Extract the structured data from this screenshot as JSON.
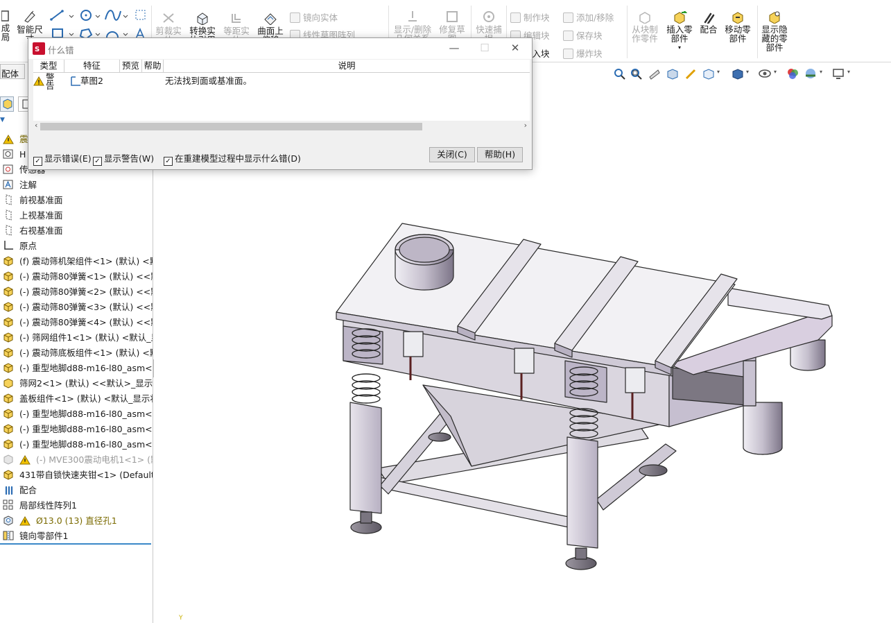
{
  "ribbon": {
    "left_cut_1": "成",
    "left_cut_2": "局",
    "smart_dim": "智能尺",
    "smart_dim_2": "寸",
    "trim": "剪裁实",
    "trim_2": "体",
    "convert": "转换实",
    "convert_2": "体引用",
    "offset": "等距实",
    "offset_2": "体",
    "surface": "曲面上",
    "surface_2": "偏移",
    "mirror": "镜向实体",
    "linear_pattern": "线性草图阵列",
    "show_delete": "显示/删除",
    "show_delete_2": "几何关系",
    "repair": "修复草",
    "repair_2": "图",
    "quick_snap": "快速捕",
    "quick_snap_2": "捉",
    "make_block": "制作块",
    "edit_block": "编辑块",
    "insert_block": "插入块",
    "add_remove": "添加/移除",
    "save_block": "保存块",
    "explode_block": "爆炸块",
    "from_block": "从块制",
    "from_block_2": "作零件",
    "insert_part": "插入零",
    "insert_part_2": "部件",
    "mate": "配合",
    "move_comp": "移动零",
    "move_comp_2": "部件",
    "show_hidden": "显示隐",
    "show_hidden_2": "藏的零",
    "show_hidden_3": "部件"
  },
  "left_panel": {
    "config_tab": "配体",
    "tree": [
      {
        "icon": "warning-icon",
        "label": "震",
        "style": "warn-text"
      },
      {
        "icon": "history-icon",
        "label": "H",
        "style": ""
      },
      {
        "icon": "sensor-icon",
        "label": "传感器",
        "style": ""
      },
      {
        "icon": "annotation-icon",
        "label": "注解",
        "style": ""
      },
      {
        "icon": "plane-icon",
        "label": "前视基准面",
        "style": ""
      },
      {
        "icon": "plane-icon",
        "label": "上视基准面",
        "style": ""
      },
      {
        "icon": "plane-icon",
        "label": "右视基准面",
        "style": ""
      },
      {
        "icon": "origin-icon",
        "label": "原点",
        "style": ""
      },
      {
        "icon": "assembly-icon",
        "label": "(f) 震动筛机架组件<1> (默认) <默认",
        "style": ""
      },
      {
        "icon": "assembly-icon",
        "label": "(-) 震动筛80弹簧<1> (默认) <<默认",
        "style": ""
      },
      {
        "icon": "assembly-icon",
        "label": "(-) 震动筛80弹簧<2> (默认) <<默认",
        "style": ""
      },
      {
        "icon": "assembly-icon",
        "label": "(-) 震动筛80弹簧<3> (默认) <<默认",
        "style": ""
      },
      {
        "icon": "assembly-icon",
        "label": "(-) 震动筛80弹簧<4> (默认) <<默认",
        "style": ""
      },
      {
        "icon": "assembly-icon",
        "label": "(-) 筛网组件1<1> (默认) <默认_显示",
        "style": ""
      },
      {
        "icon": "assembly-icon",
        "label": "(-) 震动筛底板组件<1> (默认) <默认",
        "style": ""
      },
      {
        "icon": "assembly-icon",
        "label": "(-) 重型地脚d88-m16-l80_asm<1>",
        "style": ""
      },
      {
        "icon": "part-icon",
        "label": "筛网2<1> (默认) <<默认>_显示状态",
        "style": ""
      },
      {
        "icon": "assembly-icon",
        "label": "盖板组件<1> (默认) <默认_显示状态",
        "style": ""
      },
      {
        "icon": "assembly-icon",
        "label": "(-) 重型地脚d88-m16-l80_asm<2>",
        "style": ""
      },
      {
        "icon": "assembly-icon",
        "label": "(-) 重型地脚d88-m16-l80_asm<3>",
        "style": ""
      },
      {
        "icon": "assembly-icon",
        "label": "(-) 重型地脚d88-m16-l80_asm<4>",
        "style": ""
      },
      {
        "icon": "suppressed-icon",
        "label": "(-) MVE300震动电机1<1> (默认",
        "style": "dim"
      },
      {
        "icon": "assembly-icon",
        "label": "431带自锁快速夹钳<1> (Default)",
        "style": ""
      },
      {
        "icon": "mates-icon",
        "label": "配合",
        "style": ""
      },
      {
        "icon": "pattern-icon",
        "label": "局部线性阵列1",
        "style": ""
      },
      {
        "icon": "hole-icon",
        "label": "Ø13.0 (13) 直径孔1",
        "style": "warn-text"
      },
      {
        "icon": "mirror-icon",
        "label": "镜向零部件1",
        "style": ""
      }
    ]
  },
  "dialog": {
    "title": "什么错",
    "columns": [
      "类型",
      "特征",
      "预览",
      "帮助",
      "说明"
    ],
    "rows": [
      {
        "type_1": "警",
        "type_2": "告",
        "feature": "草图2",
        "preview": "",
        "help": "",
        "description": "无法找到面或基准面。"
      }
    ],
    "show_errors": "显示错误(E)",
    "show_warnings": "显示警告(W)",
    "show_during_rebuild": "在重建模型过程中显示什么错(D)",
    "close_button": "关闭(C)",
    "help_button": "帮助(H)",
    "minimize": "—",
    "maximize": "☐",
    "close": "✕"
  },
  "colors": {
    "accent": "#3a88c8",
    "warning": "#f2c200",
    "assembly": "#e8b400",
    "disabled_text": "#a8a8a8"
  }
}
